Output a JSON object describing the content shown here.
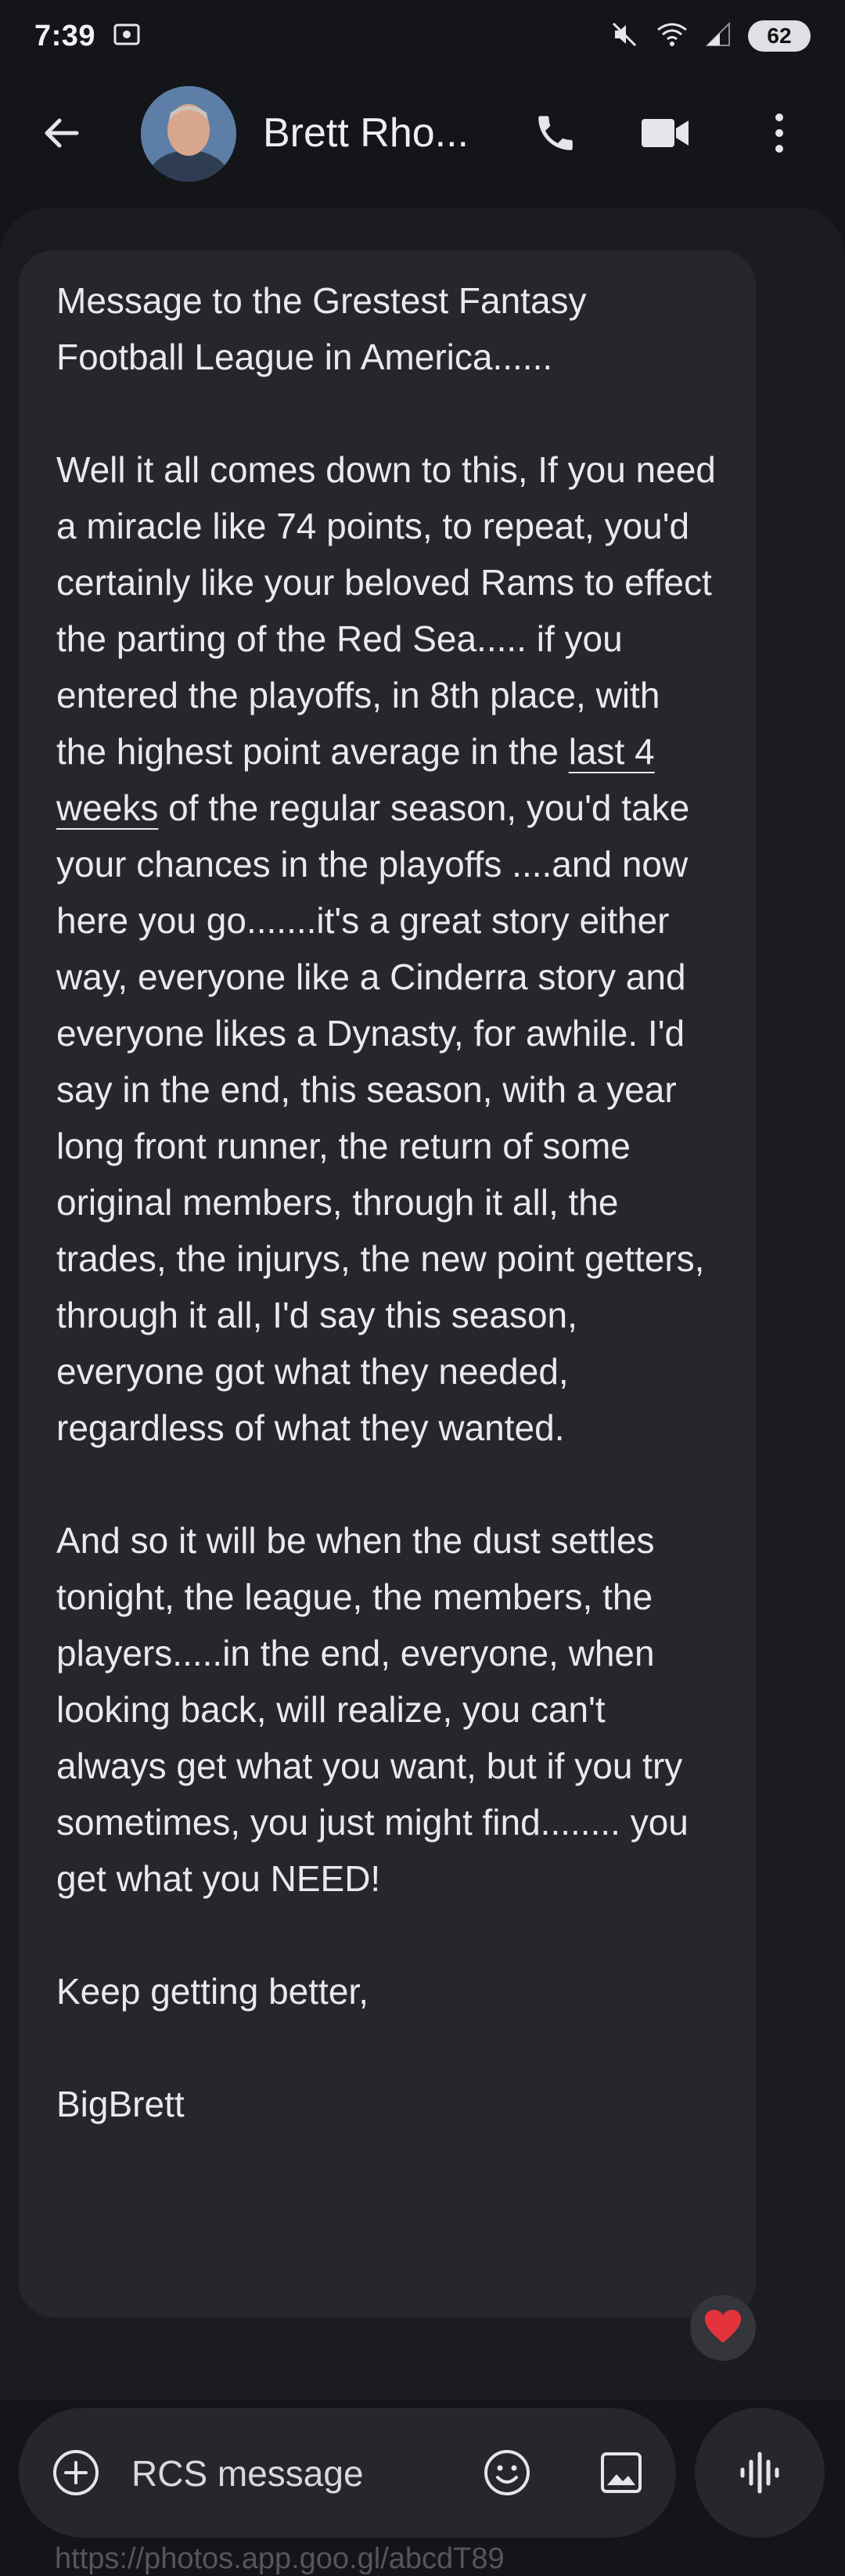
{
  "status_bar": {
    "time": "7:39",
    "battery": "62",
    "icons": [
      "screen-record-icon",
      "mute-icon",
      "wifi-icon",
      "signal-icon",
      "battery-icon"
    ]
  },
  "header": {
    "contact_name": "Brett Rho...",
    "icons": [
      "back-arrow-icon",
      "phone-icon",
      "video-camera-icon",
      "more-vert-icon"
    ]
  },
  "message": {
    "paragraphs": [
      "Message to the Grestest Fantasy Football League in America......",
      {
        "before_link": "Well it all comes down to this, If you need a miracle like 74 points, to repeat, you'd certainly like your beloved Rams to effect the parting of the Red Sea..... if you entered the playoffs, in 8th place, with the highest point average in the ",
        "link": "last 4 weeks",
        "after_link": " of the regular season, you'd take your chances in the playoffs ....and now here you go.......it's a great story either way, everyone like a Cinderra story and everyone likes a Dynasty, for awhile.   I'd say in the end, this season, with a year long front runner, the return of some original members, through it all, the trades, the injurys, the new point getters, through it all, I'd say this season, everyone got what they needed, regardless of what they wanted."
      },
      "And so it will be when the dust settles tonight, the league, the members, the players.....in the end, everyone, when looking back, will realize, you can't always get what you want, but if you try sometimes, you just might find........ you get what you NEED!",
      "Keep getting better,",
      "BigBrett"
    ],
    "reaction": "❤️"
  },
  "composer": {
    "placeholder": "RCS message",
    "icons": [
      "add-icon",
      "emoji-icon",
      "gallery-icon",
      "voice-waveform-icon"
    ]
  },
  "below_hint": "https://photos.app.goo.gl/abcdT89"
}
